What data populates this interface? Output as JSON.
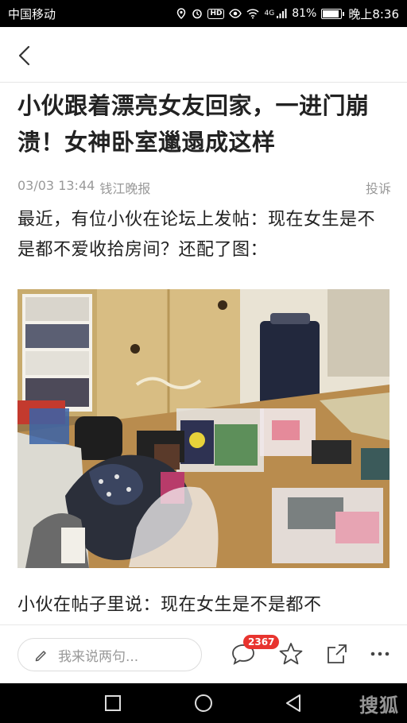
{
  "status_bar": {
    "carrier": "中国移动",
    "network": "4G",
    "battery_percent": "81%",
    "battery_level": 0.81,
    "time": "晚上8:36",
    "icons": [
      "location-icon",
      "alarm-icon",
      "hd-icon",
      "eye-icon",
      "wifi-icon",
      "signal-icon",
      "battery-icon"
    ],
    "hd_label": "HD"
  },
  "header": {
    "back_icon": "chevron-left-icon"
  },
  "article": {
    "title": "小伙跟着漂亮女友回家，一进门崩溃！女神卧室邋遢成这样",
    "date": "03/03 13:44",
    "source": "钱江晚报",
    "report_label": "投诉",
    "paragraph_1": "最近，有位小伙在论坛上发帖：现在女生是不是都不爱收拾房间？还配了图：",
    "paragraph_2": "小伙在帖子里说：现在女生是不是都不"
  },
  "action_bar": {
    "comment_placeholder": "我来说两句...",
    "comment_count": "2367",
    "icons": [
      "pen-icon",
      "comment-icon",
      "star-icon",
      "share-icon",
      "more-icon"
    ]
  },
  "nav_bar": {
    "icons": [
      "recents-icon",
      "home-icon",
      "back-triangle-icon"
    ],
    "watermark": "搜狐"
  },
  "colors": {
    "accent_red": "#e8342f",
    "status_bar_bg": "#000000",
    "meta_gray": "#999999"
  }
}
